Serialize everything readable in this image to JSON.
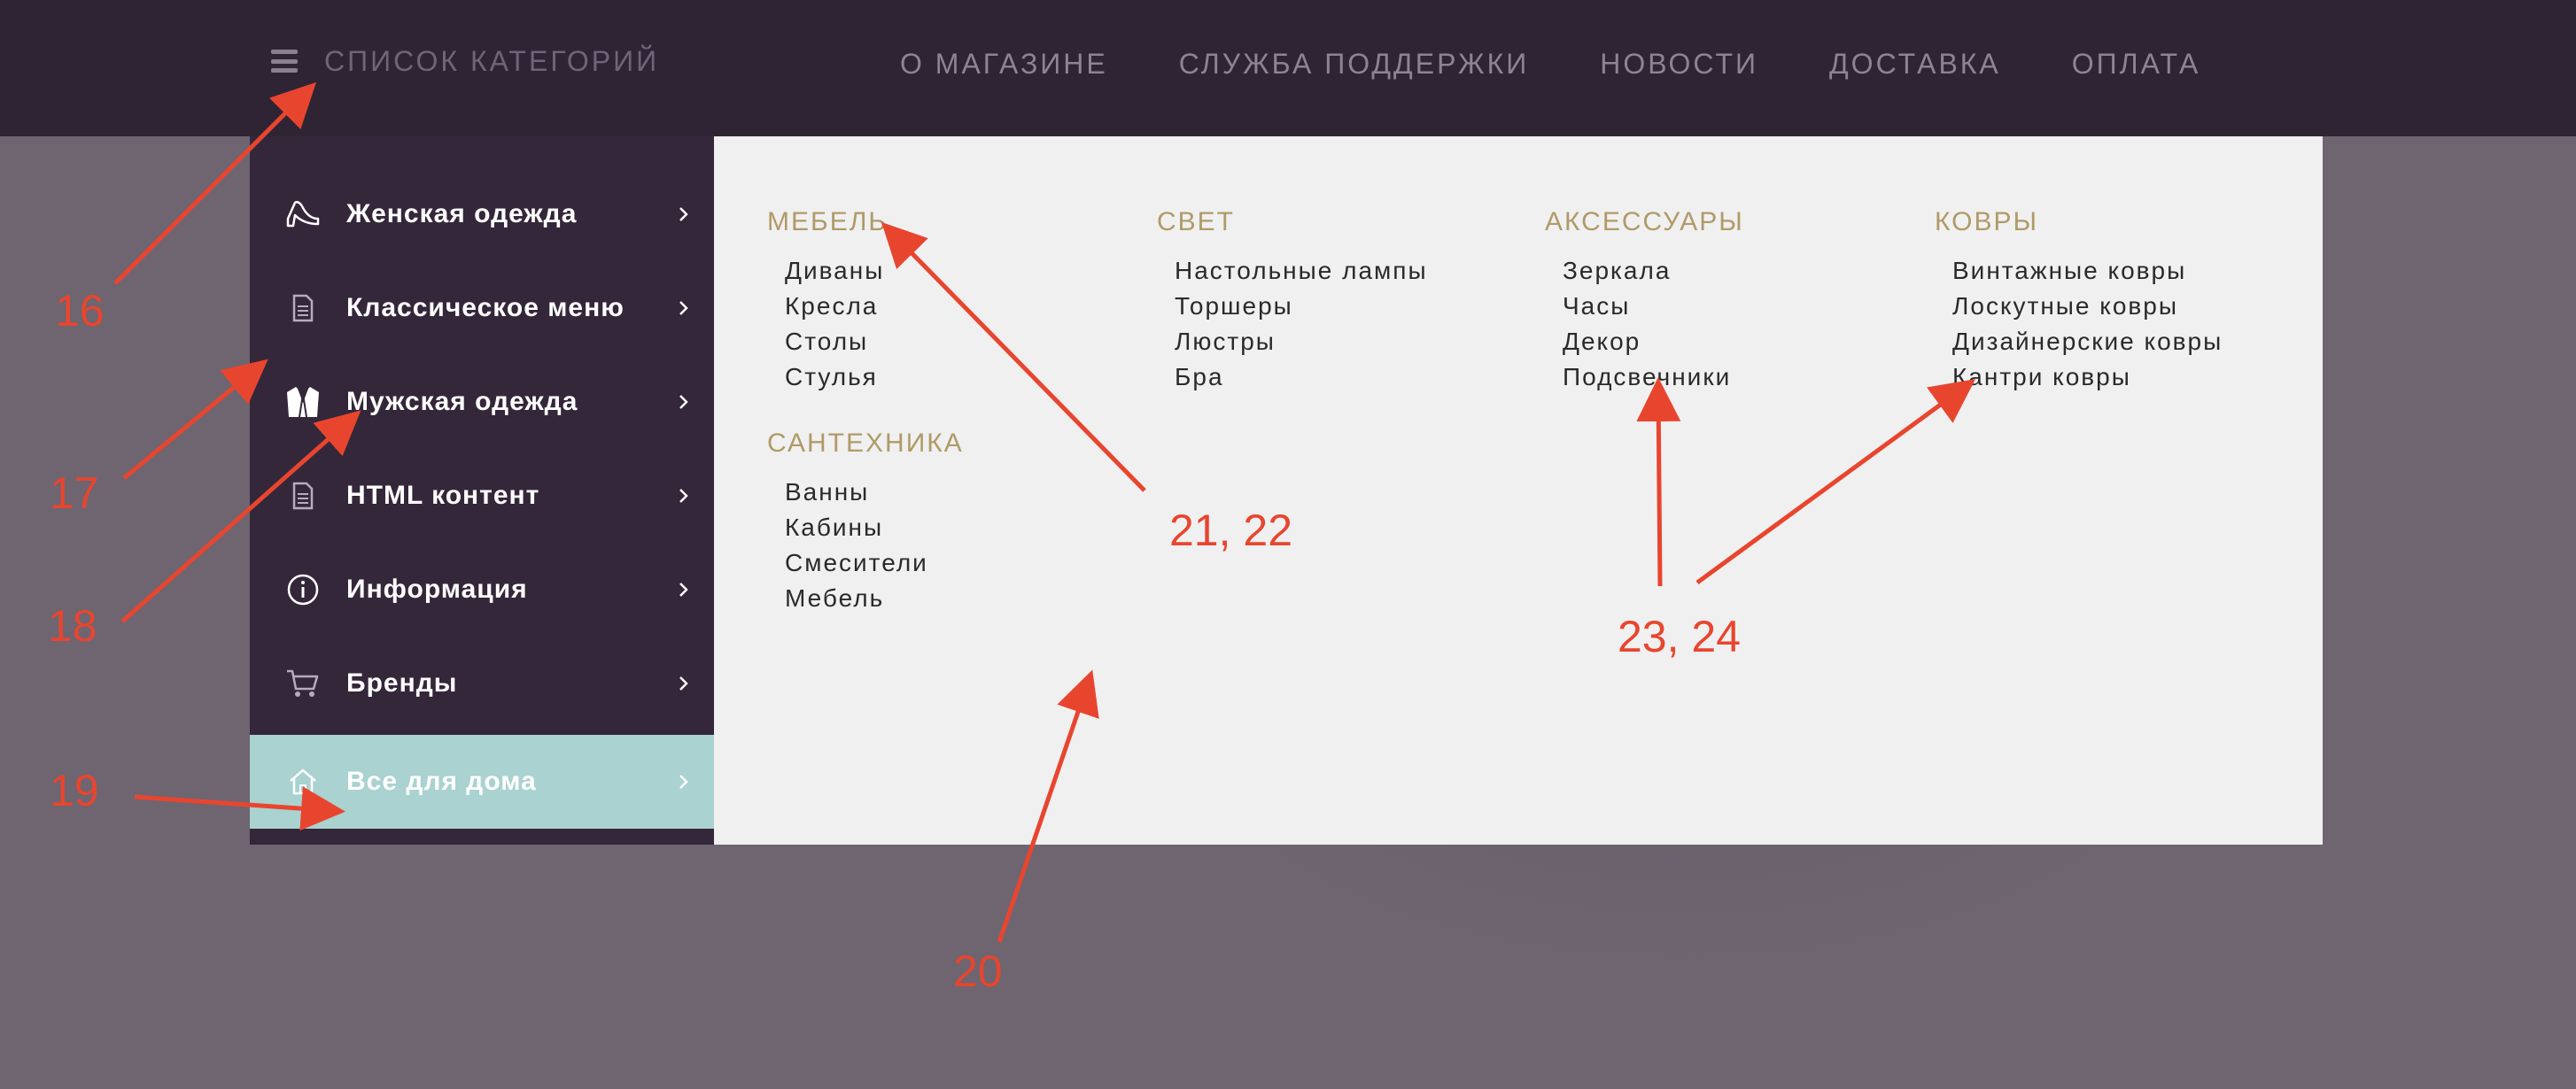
{
  "header": {
    "category_toggle_label": "СПИСОК КАТЕГОРИЙ",
    "nav": [
      {
        "label": "О МАГАЗИНЕ"
      },
      {
        "label": "СЛУЖБА ПОДДЕРЖКИ"
      },
      {
        "label": "НОВОСТИ"
      },
      {
        "label": "ДОСТАВКА"
      },
      {
        "label": "ОПЛАТА"
      }
    ]
  },
  "sidebar": {
    "items": [
      {
        "label": "Женская одежда",
        "icon": "high-heel-icon"
      },
      {
        "label": "Классическое меню",
        "icon": "document-icon"
      },
      {
        "label": "Мужская одежда",
        "icon": "jacket-icon"
      },
      {
        "label": "HTML контент",
        "icon": "document-icon"
      },
      {
        "label": "Информация",
        "icon": "info-icon"
      },
      {
        "label": "Бренды",
        "icon": "cart-icon"
      },
      {
        "label": "Все для дома",
        "icon": "home-icon",
        "active": true
      }
    ]
  },
  "mega": {
    "columns": [
      {
        "groups": [
          {
            "title": "МЕБЕЛЬ",
            "items": [
              "Диваны",
              "Кресла",
              "Столы",
              "Стулья"
            ]
          },
          {
            "title": "САНТЕХНИКА",
            "items": [
              "Ванны",
              "Кабины",
              "Смесители",
              "Мебель"
            ]
          }
        ]
      },
      {
        "groups": [
          {
            "title": "СВЕТ",
            "items": [
              "Настольные лампы",
              "Торшеры",
              "Люстры",
              "Бра"
            ]
          }
        ]
      },
      {
        "groups": [
          {
            "title": "АКСЕССУАРЫ",
            "items": [
              "Зеркала",
              "Часы",
              "Декор",
              "Подсвечники"
            ]
          }
        ]
      },
      {
        "groups": [
          {
            "title": "КОВРЫ",
            "items": [
              "Винтажные ковры",
              "Лоскутные ковры",
              "Дизайнерские ковры",
              "Кантри ковры"
            ]
          }
        ]
      }
    ]
  },
  "annotations": {
    "labels": [
      "16",
      "17",
      "18",
      "19",
      "20",
      "21, 22",
      "23, 24"
    ],
    "color": "#e8452f"
  },
  "colors": {
    "header_bg": "#2f2434",
    "sidebar_bg": "#34273a",
    "active_item_bg": "#a9d2d0",
    "panel_bg": "#f0f0f0",
    "group_title": "#b09a68",
    "page_overlay": "#6e6570"
  }
}
